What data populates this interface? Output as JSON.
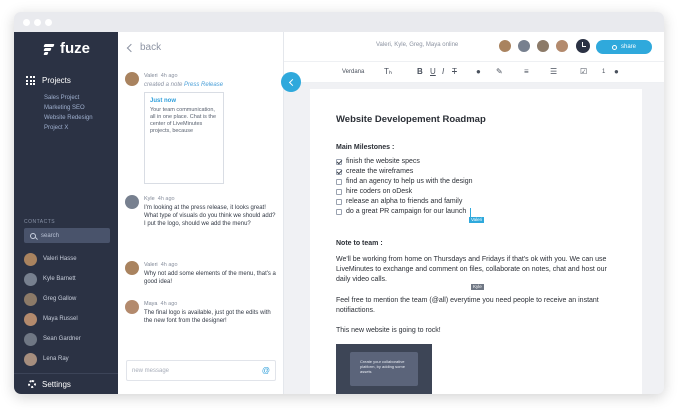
{
  "app": {
    "brand": "fuze",
    "back_label": "back",
    "share_label": "share",
    "participants": "Valeri, Kyle, Greg, Maya online"
  },
  "sidebar": {
    "projects_label": "Projects",
    "projects": [
      "Sales Project",
      "Marketing SEO",
      "Website Redesign",
      "Project X"
    ],
    "contacts_label": "CONTACTS",
    "search_placeholder": "search",
    "contacts": [
      {
        "name": "Valeri Hasse",
        "color": "#a9835f"
      },
      {
        "name": "Kyle Barnett",
        "color": "#77808f"
      },
      {
        "name": "Greg Gallow",
        "color": "#8c7a68"
      },
      {
        "name": "Maya Russel",
        "color": "#b38a6d"
      },
      {
        "name": "Sean Gardner",
        "color": "#6f7784"
      },
      {
        "name": "Lena Ray",
        "color": "#a68e7e"
      }
    ],
    "settings_label": "Settings"
  },
  "chat": {
    "messages": [
      {
        "author": "Valeri",
        "time": "4h ago",
        "meta_prefix": "created a note",
        "meta_link": "Press Release",
        "quote_title": "Just now",
        "quote_text": "Your team communication, all in one place. Chat is the center of LiveMinutes projects, because",
        "avatar_color": "#a9835f"
      },
      {
        "author": "Kyle",
        "time": "4h ago",
        "text": "I'm looking at the press release, it looks great! What type of visuals do you think we should add? I put the logo, should we add the menu?",
        "avatar_color": "#77808f"
      },
      {
        "author": "Valeri",
        "time": "4h ago",
        "text": "Why not add some elements of the menu, that's a good idea!",
        "avatar_color": "#a9835f"
      },
      {
        "author": "Maya",
        "time": "4h ago",
        "text": "The final logo is available, just got the edits with the new font from the designer!",
        "avatar_color": "#b38a6d"
      }
    ],
    "composer_placeholder": "new message"
  },
  "toolbar": {
    "font": "Verdana",
    "bold": "B",
    "underline": "U",
    "italic": "I",
    "strike": "T",
    "count": "1"
  },
  "document": {
    "title": "Website Developement Roadmap",
    "milestones_heading": "Main Milestones :",
    "milestones": [
      {
        "text": "finish the website specs",
        "checked": true
      },
      {
        "text": "create the wireframes",
        "checked": true
      },
      {
        "text": "find an agency to help us with the design",
        "checked": false
      },
      {
        "text": "hire coders on oDesk",
        "checked": false
      },
      {
        "text": "release an alpha to friends and family",
        "checked": false
      },
      {
        "text": "do a great PR campaign for our launch",
        "checked": false
      }
    ],
    "cursor_valeri": "Valeri",
    "cursor_kyle": "Kyle",
    "note_heading": "Note to team :",
    "para1": "We'll be working from home on Thursdays and Fridays if that's ok with you. We can use LiveMinutes to exchange and comment on files, collaborate on notes, chat and host our daily video calls.",
    "para2": "Feel free to mention the team (@all) everytime you need people to receive an instant notifiactions.",
    "para3": "This new website is going to rock!",
    "image_caption": "Create your collaborative platform, by adding some assets"
  },
  "colors": {
    "accent": "#2fa9dc",
    "sidebar": "#2b3244",
    "cursor_valeri": "#2fa9dc",
    "cursor_kyle": "#6f7784"
  },
  "icons": [
    "fuze-logo-icon",
    "grid-icon",
    "search-icon",
    "gear-icon",
    "chevron-left-icon",
    "at-icon",
    "clock-icon",
    "share-icon",
    "checkbox-icon"
  ]
}
